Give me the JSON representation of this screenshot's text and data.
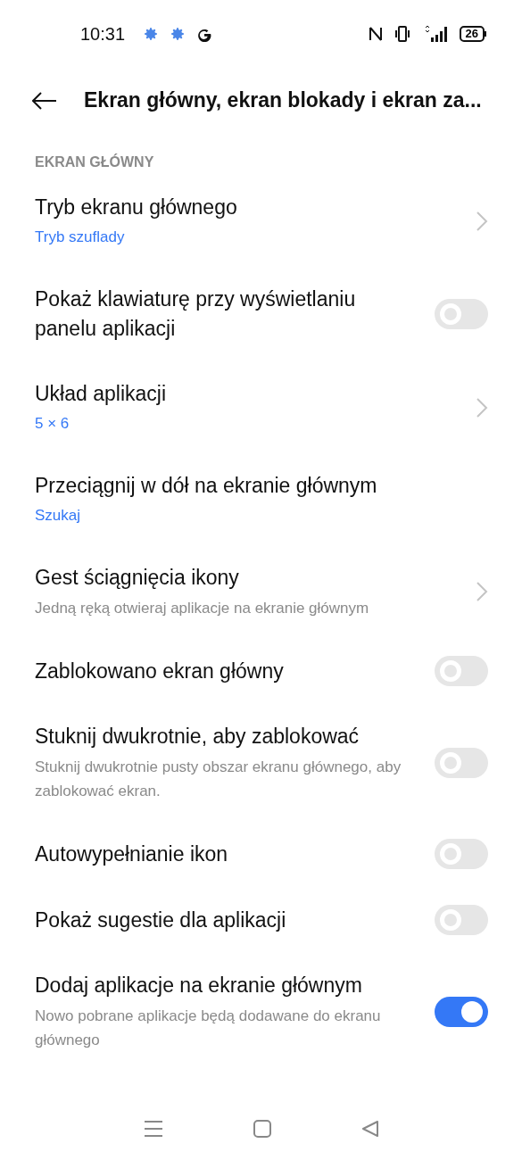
{
  "status_bar": {
    "time": "10:31",
    "battery": "26"
  },
  "header": {
    "title": "Ekran główny, ekran blokady i ekran za..."
  },
  "section": {
    "title": "EKRAN GŁÓWNY"
  },
  "rows": [
    {
      "kind": "link",
      "title": "Tryb ekranu głównego",
      "value": "Tryb szuflady"
    },
    {
      "kind": "switch",
      "title": "Pokaż klawiaturę przy wyświetlaniu panelu aplikacji",
      "on": false
    },
    {
      "kind": "link",
      "title": "Układ aplikacji",
      "value": "5 × 6"
    },
    {
      "kind": "plain",
      "title": "Przeciągnij w dół na ekranie głównym",
      "value": "Szukaj"
    },
    {
      "kind": "link",
      "title": "Gest ściągnięcia ikony",
      "description": "Jedną ręką otwieraj aplikacje na ekranie głównym"
    },
    {
      "kind": "switch",
      "title": "Zablokowano ekran główny",
      "on": false
    },
    {
      "kind": "switch",
      "title": "Stuknij dwukrotnie, aby zablokować",
      "description": "Stuknij dwukrotnie pusty obszar ekranu głównego, aby zablokować ekran.",
      "on": false
    },
    {
      "kind": "switch",
      "title": "Autowypełnianie ikon",
      "on": false
    },
    {
      "kind": "switch",
      "title": "Pokaż sugestie dla aplikacji",
      "on": false
    },
    {
      "kind": "switch",
      "title": "Dodaj aplikacje na ekranie głównym",
      "description": "Nowo pobrane aplikacje będą dodawane do ekranu głównego",
      "on": true
    }
  ]
}
